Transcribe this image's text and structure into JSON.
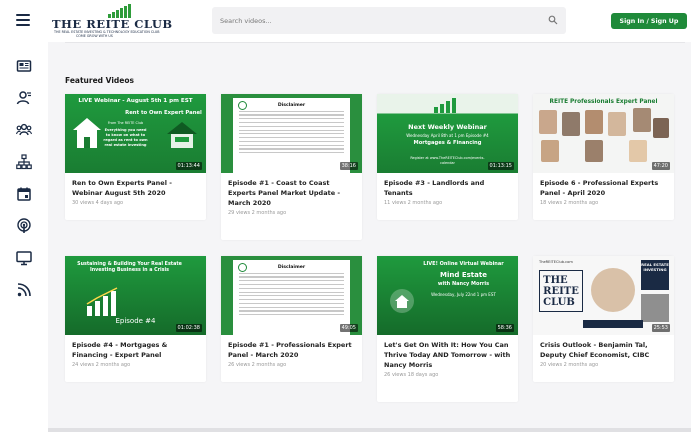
{
  "header": {
    "logo_text": "THE REITE CLUB",
    "logo_tagline": "THE REAL ESTATE INVESTING & TECHNOLOGY EDUCATION CLUB",
    "logo_sub": "COME GROW WITH US",
    "search_placeholder": "Search videos...",
    "signin_label": "Sign In / Sign Up"
  },
  "sidebar": {
    "icons": [
      "hamburger-icon",
      "news-icon",
      "user-icon",
      "group-icon",
      "network-icon",
      "calendar-icon",
      "podcast-icon",
      "monitor-icon",
      "blog-icon"
    ]
  },
  "section": {
    "title": "Featured Videos"
  },
  "videos": [
    {
      "title": "Ren to Own Experts Panel - Webinar August 5th 2020",
      "meta": "30 views 4 days ago",
      "duration": "01:13:44",
      "thumb_line1": "LIVE Webinar - August 5th 1 pm EST",
      "thumb_line2": "Rent to Own Expert Panel",
      "thumb_line3": "Everything you need to know on what to regard as rent to own real estate investing",
      "thumb_line4": "From The REITE Club"
    },
    {
      "title": "Episode #1 - Coast to Coast Experts Panel Market Update - March 2020",
      "meta": "29 views 2 months ago",
      "duration": "38:16",
      "thumb_line1": "Disclaimer"
    },
    {
      "title": "Episode #3 - Landlords and Tenants",
      "meta": "11 views 2 months ago",
      "duration": "01:13:15",
      "thumb_line1": "Next Weekly Webinar",
      "thumb_line2": "Wednesday April 8th at 1 pm Episode #4",
      "thumb_line3": "Mortgages & Financing",
      "thumb_line4": "Register at www.TheREITEClub.com/events-calendar"
    },
    {
      "title": "Episode 6 - Professional Experts Panel - April 2020",
      "meta": "18 views 2 months ago",
      "duration": "47:20",
      "thumb_line1": "REITE Professionals Expert Panel"
    },
    {
      "title": "Episode #4 - Mortgages & Financing - Expert Panel",
      "meta": "24 views 2 months ago",
      "duration": "01:02:38",
      "thumb_line1": "Sustaining & Building Your Real Estate Investing Business in a Crisis",
      "thumb_line2": "Episode #4"
    },
    {
      "title": "Episode #1 - Professionals Expert Panel - March 2020",
      "meta": "26 views 2 months ago",
      "duration": "49:05",
      "thumb_line1": "Disclaimer"
    },
    {
      "title": "Let's Get On With It: How You Can Thrive Today AND Tomorrow - with Nancy Morris",
      "meta": "26 views 18 days ago",
      "duration": "58:36",
      "thumb_line1": "LIVE! Online Virtual Webinar",
      "thumb_line2": "Mind Estate",
      "thumb_line3": "with Nancy Morris",
      "thumb_line4": "Wednesday, July 22nd 1 pm EST"
    },
    {
      "title": "Crisis Outlook - Benjamin Tal, Deputy Chief Economist, CIBC",
      "meta": "20 views 2 months ago",
      "duration": "25:53",
      "thumb_line1": "TheREITEClub.com",
      "thumb_line2": "REAL ESTATE INVESTING"
    }
  ],
  "colors": {
    "brand_green": "#1f8a3a",
    "navy": "#1a2a44",
    "bg": "#f5f5f7"
  }
}
